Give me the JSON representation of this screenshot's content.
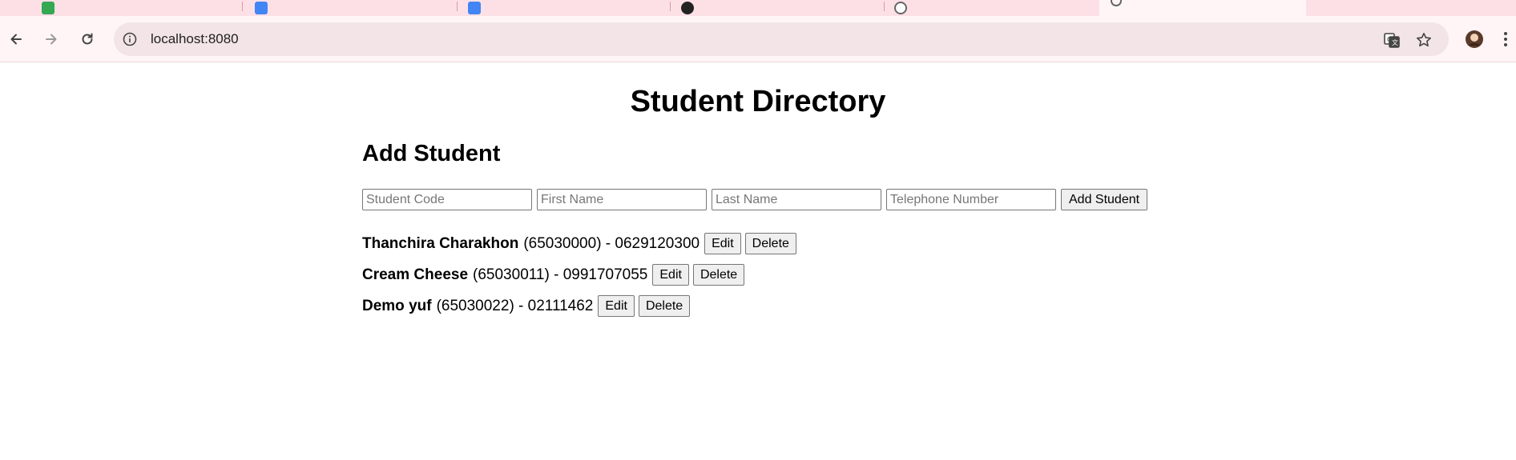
{
  "browser": {
    "url": "localhost:8080",
    "tabs": [
      {
        "label": "",
        "color": "#4caf50"
      },
      {
        "label": "",
        "color": "#4285f4"
      },
      {
        "label": "",
        "color": "#4285f4"
      },
      {
        "label": "",
        "color": "#222222"
      },
      {
        "label": "",
        "color": "#888888"
      },
      {
        "label": "",
        "color": "#888888",
        "active": true
      }
    ],
    "icons": {
      "back": "back-arrow-icon",
      "forward": "forward-arrow-icon",
      "reload": "reload-icon",
      "info": "info-icon",
      "translate": "translate-icon",
      "bookmark": "star-icon",
      "menu": "vertical-dots-icon"
    }
  },
  "page": {
    "title": "Student Directory",
    "add_section_title": "Add Student",
    "form": {
      "code_placeholder": "Student Code",
      "first_name_placeholder": "First Name",
      "last_name_placeholder": "Last Name",
      "phone_placeholder": "Telephone Number",
      "submit_label": "Add Student"
    },
    "students": [
      {
        "name": "Thanchira Charakhon",
        "details": "(65030000) - 0629120300",
        "edit_label": "Edit",
        "delete_label": "Delete"
      },
      {
        "name": "Cream Cheese",
        "details": "(65030011) - 0991707055",
        "edit_label": "Edit",
        "delete_label": "Delete"
      },
      {
        "name": "Demo yuf",
        "details": "(65030022) - 02111462",
        "edit_label": "Edit",
        "delete_label": "Delete"
      }
    ]
  }
}
